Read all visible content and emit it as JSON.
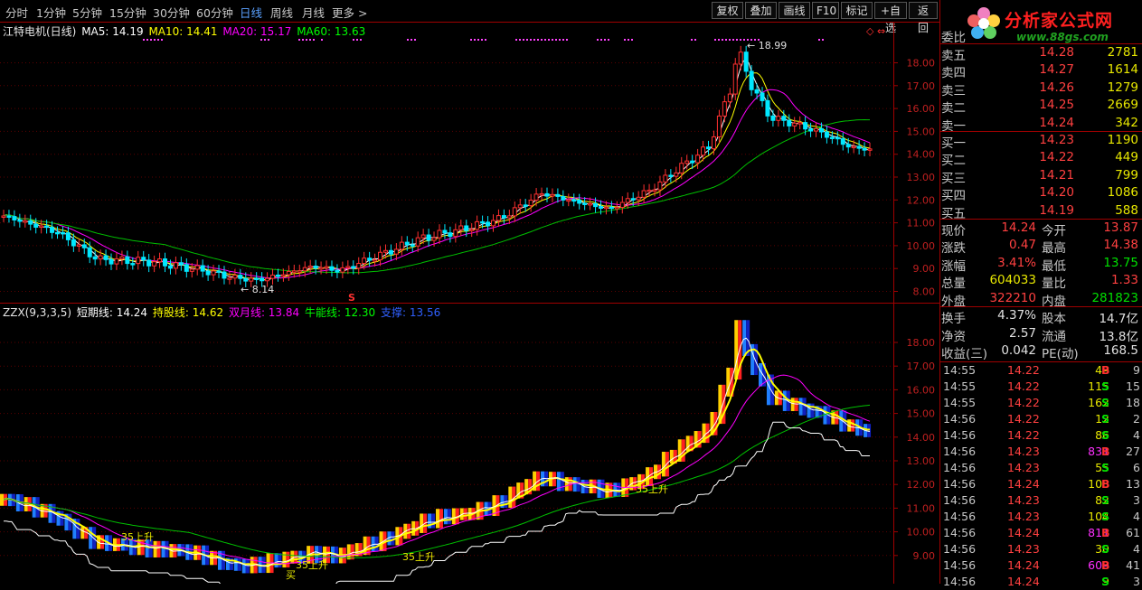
{
  "toolbar": {
    "period_tabs": [
      {
        "label": "分时",
        "active": false
      },
      {
        "label": "1分钟",
        "active": false
      },
      {
        "label": "5分钟",
        "active": false
      },
      {
        "label": "15分钟",
        "active": false
      },
      {
        "label": "30分钟",
        "active": false
      },
      {
        "label": "60分钟",
        "active": false
      },
      {
        "label": "日线",
        "active": true
      },
      {
        "label": "周线",
        "active": false
      },
      {
        "label": "月线",
        "active": false
      },
      {
        "label": "更多",
        "active": false
      }
    ],
    "more_chevron": ">",
    "right_buttons": [
      "复权",
      "叠加",
      "画线",
      "F10",
      "标记",
      "+自选",
      "返回"
    ]
  },
  "main_chart": {
    "stock_title": "江特电机(日线)",
    "ma_legend": [
      {
        "label": "MA5: 14.19",
        "color": "#ffffff"
      },
      {
        "label": "MA10: 14.41",
        "color": "#ffff00"
      },
      {
        "label": "MA20: 15.17",
        "color": "#ff00ff"
      },
      {
        "label": "MA60: 13.63",
        "color": "#00ff00"
      }
    ],
    "high_annotation": "18.99",
    "low_annotation": "8.14",
    "signal_marker": "S",
    "corner_icons": "◇ ⇔",
    "y_axis_labels": [
      "18.00",
      "17.00",
      "16.00",
      "15.00",
      "14.00",
      "13.00",
      "12.00",
      "11.00",
      "10.00",
      "9.00",
      "8.00"
    ]
  },
  "indicator_chart": {
    "name": "ZZX(9,3,3,5)",
    "legend": [
      {
        "label": "短期线: 14.24",
        "color": "#ffffff"
      },
      {
        "label": "持股线: 14.62",
        "color": "#ffff00"
      },
      {
        "label": "双月线: 13.84",
        "color": "#ff00ff"
      },
      {
        "label": "牛能线: 12.30",
        "color": "#00ff00"
      },
      {
        "label": "支撑: 13.56",
        "color": "#3060ff"
      }
    ],
    "annotations": [
      "35上升",
      "35上升",
      "35上升",
      "35上升",
      "买"
    ],
    "y_axis_labels": [
      "18.00",
      "17.00",
      "16.00",
      "15.00",
      "14.00",
      "13.00",
      "12.00",
      "11.00",
      "10.00",
      "9.00"
    ]
  },
  "watermark": {
    "brand": "分析家公式网",
    "url": "www.88gs.com"
  },
  "order_book": {
    "header_label": "委比",
    "sell": [
      {
        "label": "卖五",
        "price": "14.28",
        "vol": "2781"
      },
      {
        "label": "卖四",
        "price": "14.27",
        "vol": "1614"
      },
      {
        "label": "卖三",
        "price": "14.26",
        "vol": "1279"
      },
      {
        "label": "卖二",
        "price": "14.25",
        "vol": "2669"
      },
      {
        "label": "卖一",
        "price": "14.24",
        "vol": "342"
      }
    ],
    "buy": [
      {
        "label": "买一",
        "price": "14.23",
        "vol": "1190"
      },
      {
        "label": "买二",
        "price": "14.22",
        "vol": "449"
      },
      {
        "label": "买三",
        "price": "14.21",
        "vol": "799"
      },
      {
        "label": "买四",
        "price": "14.20",
        "vol": "1086"
      },
      {
        "label": "买五",
        "price": "14.19",
        "vol": "588"
      }
    ]
  },
  "quote": [
    {
      "l1": "现价",
      "v1": "14.24",
      "c1": "#ff4040",
      "l2": "今开",
      "v2": "13.87",
      "c2": "#ff4040"
    },
    {
      "l1": "涨跌",
      "v1": "0.47",
      "c1": "#ff4040",
      "l2": "最高",
      "v2": "14.38",
      "c2": "#ff4040"
    },
    {
      "l1": "涨幅",
      "v1": "3.41%",
      "c1": "#ff4040",
      "l2": "最低",
      "v2": "13.75",
      "c2": "#00e000"
    },
    {
      "l1": "总量",
      "v1": "604033",
      "c1": "#e8e800",
      "l2": "量比",
      "v2": "1.33",
      "c2": "#ff4040"
    },
    {
      "l1": "外盘",
      "v1": "322210",
      "c1": "#ff4040",
      "l2": "内盘",
      "v2": "281823",
      "c2": "#00e000"
    }
  ],
  "fundamentals": [
    {
      "l1": "换手",
      "v1": "4.37%",
      "l2": "股本",
      "v2": "14.7亿"
    },
    {
      "l1": "净资",
      "v1": "2.57",
      "l2": "流通",
      "v2": "13.8亿"
    },
    {
      "l1": "收益(三)",
      "v1": "0.042",
      "l2": "PE(动)",
      "v2": "168.5"
    }
  ],
  "ticks": [
    {
      "time": "14:55",
      "price": "14.22",
      "vol": "49",
      "side": "B",
      "n": "9"
    },
    {
      "time": "14:55",
      "price": "14.22",
      "vol": "115",
      "side": "S",
      "n": "15"
    },
    {
      "time": "14:55",
      "price": "14.22",
      "vol": "162",
      "side": "S",
      "n": "18"
    },
    {
      "time": "14:56",
      "price": "14.22",
      "vol": "12",
      "side": "S",
      "n": "2"
    },
    {
      "time": "14:56",
      "price": "14.22",
      "vol": "86",
      "side": "S",
      "n": "4"
    },
    {
      "time": "14:56",
      "price": "14.23",
      "vol": "831",
      "side": "B",
      "n": "27"
    },
    {
      "time": "14:56",
      "price": "14.23",
      "vol": "55",
      "side": "S",
      "n": "6"
    },
    {
      "time": "14:56",
      "price": "14.24",
      "vol": "108",
      "side": "B",
      "n": "13"
    },
    {
      "time": "14:56",
      "price": "14.23",
      "vol": "82",
      "side": "S",
      "n": "3"
    },
    {
      "time": "14:56",
      "price": "14.23",
      "vol": "104",
      "side": "S",
      "n": "4"
    },
    {
      "time": "14:56",
      "price": "14.24",
      "vol": "811",
      "side": "B",
      "n": "61"
    },
    {
      "time": "14:56",
      "price": "14.23",
      "vol": "30",
      "side": "S",
      "n": "4"
    },
    {
      "time": "14:56",
      "price": "14.24",
      "vol": "609",
      "side": "B",
      "n": "41"
    },
    {
      "time": "14:56",
      "price": "14.24",
      "vol": "9",
      "side": "S",
      "n": "3"
    }
  ]
}
